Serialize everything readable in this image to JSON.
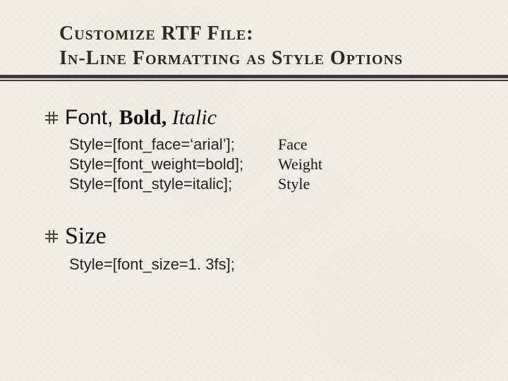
{
  "title": {
    "line1": "Customize RTF File:",
    "line2": "In-Line Formatting as Style Options"
  },
  "section_font": {
    "heading_parts": {
      "font": "Font, ",
      "bold": "Bold, ",
      "italic": "Italic"
    },
    "rows": [
      {
        "code": "Style=[font_face=‘arial’];",
        "label": "Face"
      },
      {
        "code": "Style=[font_weight=bold];",
        "label": "Weight"
      },
      {
        "code": "Style=[font_style=italic];",
        "label": "Style"
      }
    ]
  },
  "section_size": {
    "heading": "Size",
    "code": "Style=[font_size=1. 3fs];"
  }
}
